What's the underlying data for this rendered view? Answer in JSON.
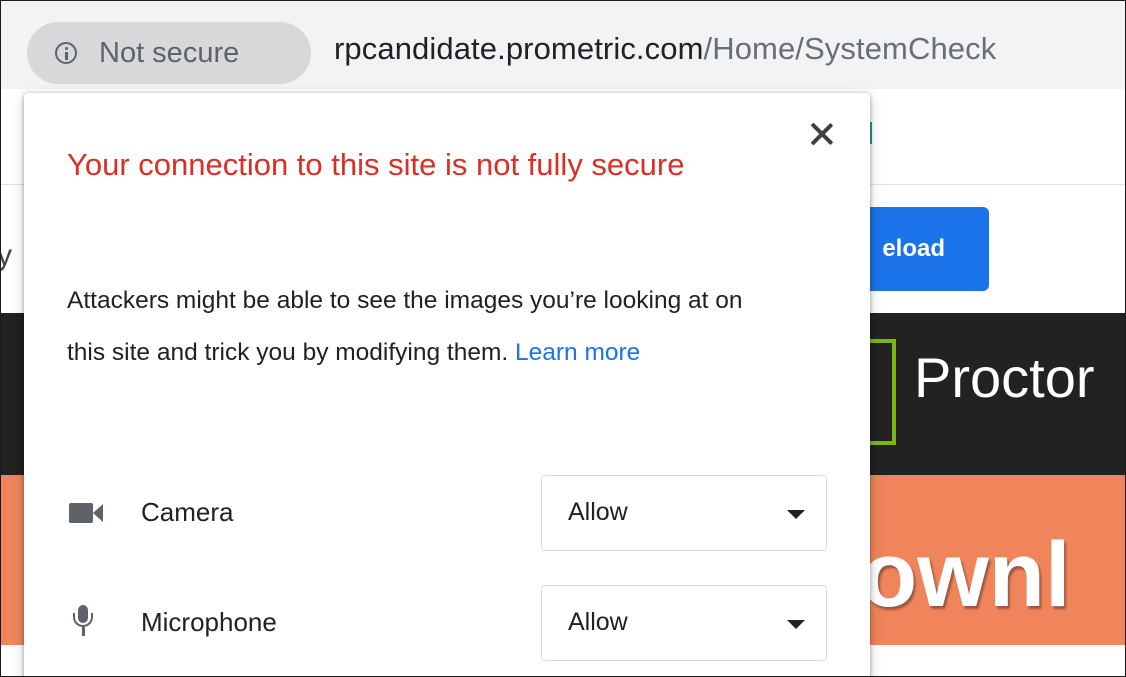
{
  "address_bar": {
    "security_chip_label": "Not secure",
    "url_host": "rpcandidate.prometric.com",
    "url_path": "/Home/SystemCheck"
  },
  "background_page": {
    "reload_button_label_partial": "eload",
    "brand_partial": "Proctor",
    "headline_partial": "ownl",
    "left_glyph_a": "I",
    "left_glyph_b": "y"
  },
  "popup": {
    "title": "Your connection to this site is not fully secure",
    "body": "Attackers might be able to see the images you’re looking at on this site and trick you by modifying them.",
    "learn_more": "Learn more",
    "permissions": [
      {
        "icon": "camera-icon",
        "label": "Camera",
        "value": "Allow"
      },
      {
        "icon": "microphone-icon",
        "label": "Microphone",
        "value": "Allow"
      }
    ]
  },
  "colors": {
    "warning_title": "#d93025",
    "link": "#1a73e8",
    "reload_button": "#1a73e8",
    "dark_band": "#222222",
    "orange_band": "#f0855c",
    "logo_accent": "#7cb518"
  }
}
